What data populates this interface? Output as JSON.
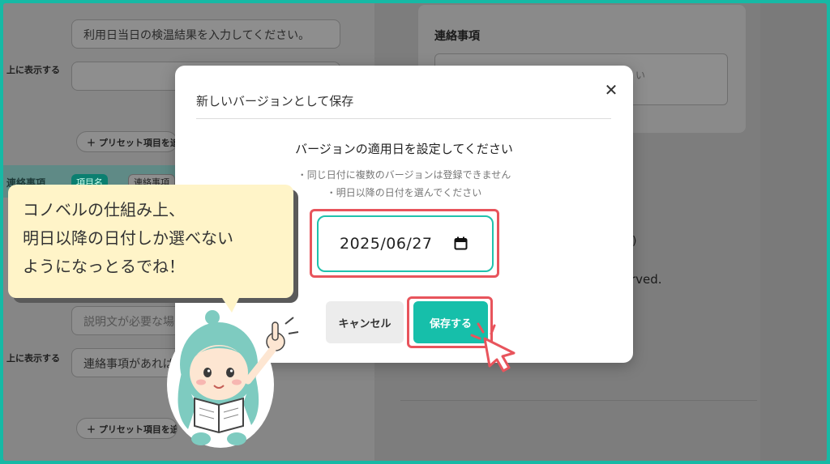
{
  "background": {
    "left_fields": [
      "利用日当日の検温結果を入力してください。",
      "",
      "説明文が必要な場",
      "連絡事項があれば"
    ],
    "side_labels": [
      "上に表示する",
      "上に表示する"
    ],
    "preset_button_label": "＋ プリセット項目を追",
    "teal_row": {
      "label": "連絡事項",
      "tag": "項目名",
      "tag2": "連絡事項"
    },
    "right_card_title": "連絡事項",
    "right_placeholder": "い",
    "right_text1": ")",
    "right_text2": "rved."
  },
  "modal": {
    "title": "新しいバージョンとして保存",
    "close_label": "✕",
    "heading": "バージョンの適用日を設定してください",
    "notes": [
      "・同じ日付に複数のバージョンは登録できません",
      "・明日以降の日付を選んでください"
    ],
    "date_value": "2025/06/27",
    "cancel_label": "キャンセル",
    "save_label": "保存する"
  },
  "callout": {
    "lines": [
      "コノベルの仕組み上、",
      "明日以降の日付しか選べない",
      "ようになっとるでね！"
    ]
  },
  "colors": {
    "accent_teal": "#16bfaa",
    "highlight_red": "#e8545c",
    "callout_yellow": "#fff4c8",
    "frame_teal": "#16b9a5"
  }
}
